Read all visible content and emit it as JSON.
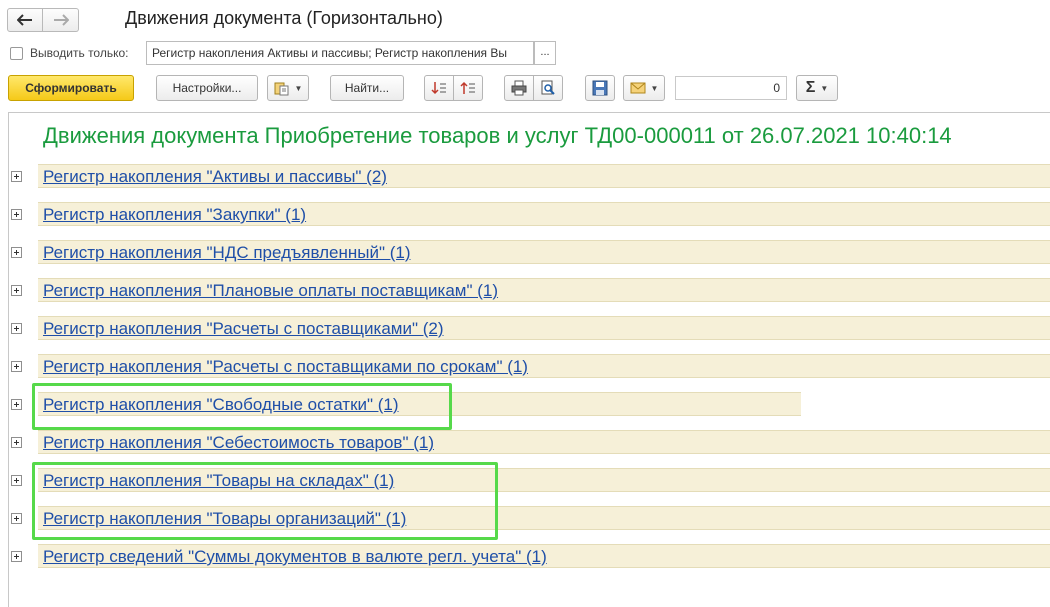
{
  "window": {
    "title": "Движения документа (Горизонтально)"
  },
  "filter": {
    "checkbox_label": "Выводить только:",
    "value": "Регистр накопления Активы и пассивы; Регистр накопления Вы",
    "select_button": "..."
  },
  "toolbar": {
    "generate_label": "Сформировать",
    "settings_label": "Настройки...",
    "find_label": "Найти...",
    "number_value": "0",
    "sum_symbol": "Σ"
  },
  "report": {
    "heading": "Движения документа Приобретение товаров и услуг ТД00-000011 от 26.07.2021 10:40:14",
    "groups": [
      "Регистр накопления \"Активы и пассивы\" (2)",
      "Регистр накопления \"Закупки\" (1)",
      "Регистр накопления \"НДС предъявленный\" (1)",
      "Регистр накопления \"Плановые оплаты поставщикам\" (1)",
      "Регистр накопления \"Расчеты с поставщиками\" (2)",
      "Регистр накопления \"Расчеты с поставщиками по срокам\" (1)",
      "Регистр накопления \"Свободные остатки\" (1)",
      "Регистр накопления \"Себестоимость товаров\" (1)",
      "Регистр накопления \"Товары на складах\" (1)",
      "Регистр накопления \"Товары организаций\" (1)",
      "Регистр сведений \"Суммы документов в валюте регл. учета\" (1)"
    ]
  },
  "colors": {
    "heading": "#1a9b3e",
    "link": "#1f4fa8",
    "row_bg": "#f6f0d8",
    "highlight": "#56d94a",
    "primary_button": "#f5c918"
  }
}
